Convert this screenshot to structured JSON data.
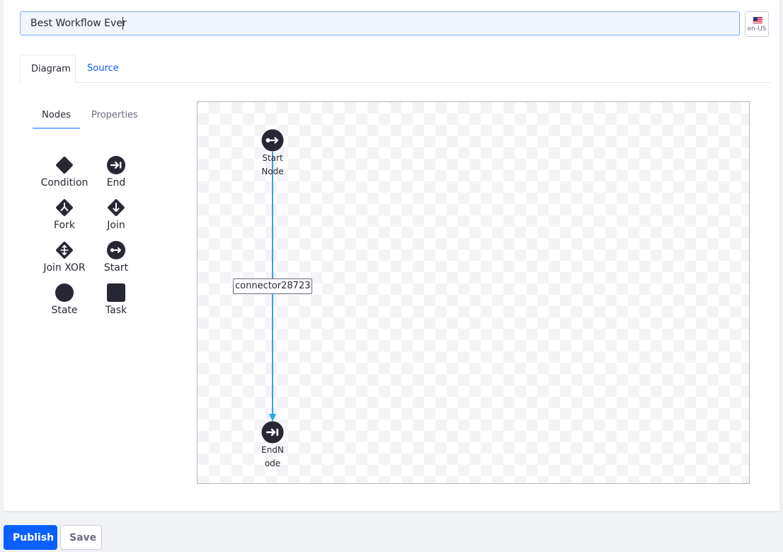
{
  "form": {
    "title_value": "Best Workflow Ever",
    "language": "en-US",
    "language_flag": "us-flag-icon"
  },
  "tabs": [
    {
      "label": "Diagram",
      "active": true
    },
    {
      "label": "Source",
      "active": false
    }
  ],
  "sidebar": {
    "subtabs": [
      {
        "label": "Nodes",
        "active": true
      },
      {
        "label": "Properties",
        "active": false
      }
    ],
    "palette": [
      {
        "label": "Condition",
        "icon": "condition-diamond-icon"
      },
      {
        "label": "End",
        "icon": "end-arrow-icon"
      },
      {
        "label": "Fork",
        "icon": "fork-icon"
      },
      {
        "label": "Join",
        "icon": "join-icon"
      },
      {
        "label": "Join XOR",
        "icon": "join-xor-icon"
      },
      {
        "label": "Start",
        "icon": "start-icon"
      },
      {
        "label": "State",
        "icon": "state-circle-icon"
      },
      {
        "label": "Task",
        "icon": "task-square-icon"
      }
    ]
  },
  "diagram": {
    "nodes": [
      {
        "label": "StartNode",
        "type": "start"
      },
      {
        "label": "EndNode",
        "type": "end"
      }
    ],
    "connector": {
      "label": "connector28723"
    }
  },
  "actions": {
    "publish_label": "Publish",
    "save_label": "Save"
  },
  "colors": {
    "accent": "#0b5fff",
    "connector": "#2fa4e7",
    "node_fill": "#272833"
  }
}
